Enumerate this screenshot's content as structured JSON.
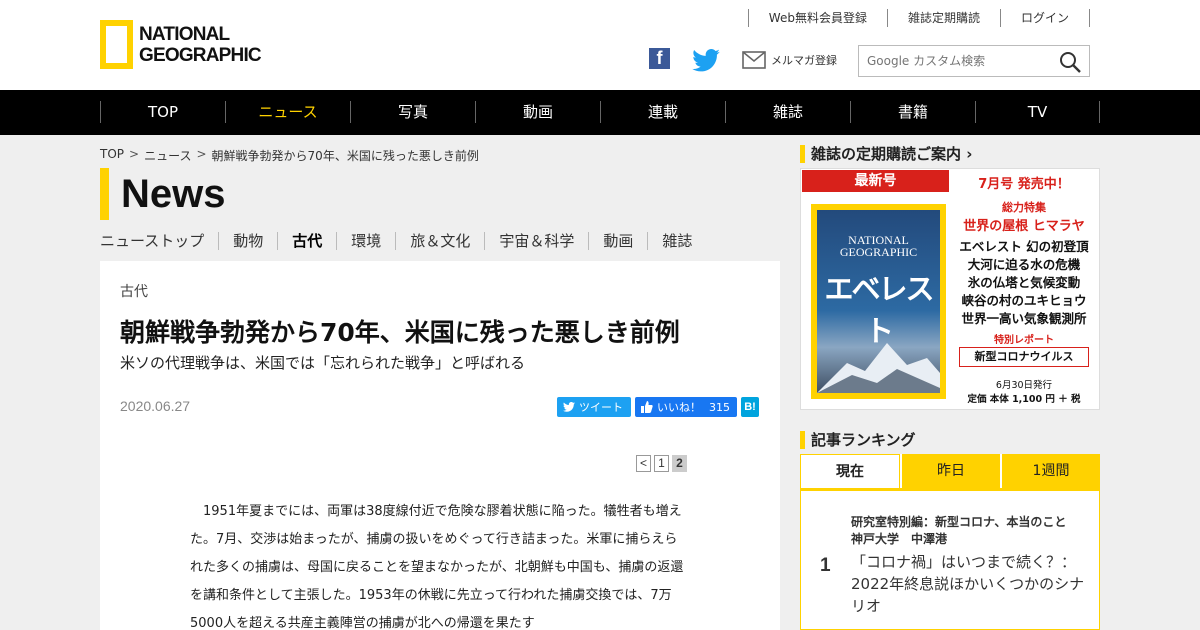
{
  "header": {
    "logo_line1": "NATIONAL",
    "logo_line2": "GEOGRAPHIC",
    "top_links": [
      "Web無料会員登録",
      "雑誌定期購読",
      "ログイン"
    ],
    "mail_label": "メルマガ登録",
    "search_placeholder": "Google カスタム検索"
  },
  "nav": {
    "items": [
      "TOP",
      "ニュース",
      "写真",
      "動画",
      "連載",
      "雑誌",
      "書籍",
      "TV"
    ],
    "active": "ニュース"
  },
  "breadcrumb": [
    "TOP",
    "ニュース",
    "朝鮮戦争勃発から70年、米国に残った悪しき前例"
  ],
  "section_title": "News",
  "subnav": {
    "items": [
      "ニューストップ",
      "動物",
      "古代",
      "環境",
      "旅＆文化",
      "宇宙＆科学",
      "動画",
      "雑誌"
    ],
    "active": "古代"
  },
  "article": {
    "category": "古代",
    "headline": "朝鮮戦争勃発から70年、米国に残った悪しき前例",
    "subhead": "米ソの代理戦争は、米国では「忘れられた戦争」と呼ばれる",
    "date": "2020.06.27",
    "share": {
      "tweet": "ツイート",
      "like": "いいね！",
      "like_count": "315",
      "hatena": "B!"
    },
    "pager": [
      "<",
      "1",
      "2"
    ],
    "body": "1951年夏までには、両軍は38度線付近で危険な膠着状態に陥った。犠牲者も増えた。7月、交渉は始まったが、捕虜の扱いをめぐって行き詰まった。米軍に捕らえられた多くの捕虜は、母国に戻ることを望まなかったが、北朝鮮も中国も、捕虜の返還を講和条件として主張した。1953年の休戦に先立って行われた捕虜交換では、7万5000人を超える共産主義陣営の捕虜が北への帰還を果たす"
  },
  "sidebar": {
    "subscribe_heading": "雑誌の定期購読ご案内",
    "magazine": {
      "latest": "最新号",
      "on_sale": "7月号 発売中！",
      "cover_logo1": "NATIONAL",
      "cover_logo2": "GEOGRAPHIC",
      "cover_title": "エベレスト",
      "feature_label": "総力特集",
      "feature_title": "世界の屋根 ヒマラヤ",
      "feature_list": [
        "エベレスト 幻の初登頂",
        "大河に迫る水の危機",
        "氷の仏塔と気候変動",
        "峡谷の村のユキヒョウ",
        "世界一高い気象観測所"
      ],
      "report_label": "特別レポート",
      "report_title": "新型コロナウイルス",
      "release": "6月30日発行",
      "price": "定価 本体 1,100 円 ＋ 税"
    },
    "ranking_heading": "記事ランキング",
    "ranking_tabs": [
      "現在",
      "昨日",
      "1週間"
    ],
    "ranking": [
      {
        "rank": "1",
        "overline": "研究室特別編：新型コロナ、本当のこと　神戸大学　中澤港",
        "title": "「コロナ禍」はいつまで続く？：2022年終息説ほかいくつかのシナリオ"
      }
    ]
  },
  "colors": {
    "accent_yellow": "#ffd200",
    "nav_bg": "#000000",
    "magazine_red": "#d8211b",
    "twitter": "#1da1f2",
    "facebook": "#3b5998"
  }
}
